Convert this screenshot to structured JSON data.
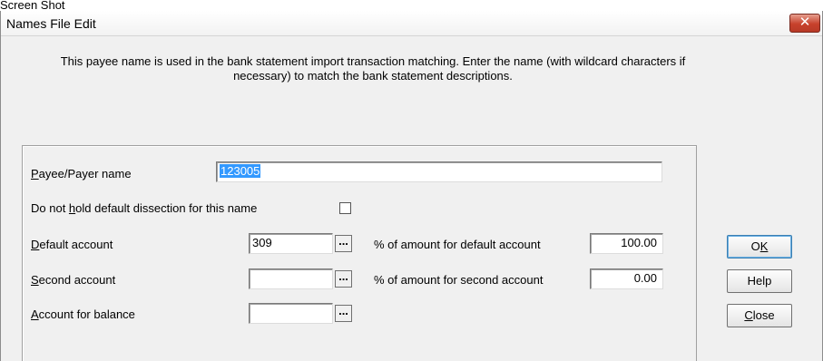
{
  "top_label": "Screen Shot",
  "window": {
    "title": "Names File Edit",
    "close_glyph": "✕",
    "description": "This payee name is used in the bank statement import transaction matching. Enter the name (with wildcard characters if necessary) to match the bank statement descriptions."
  },
  "form": {
    "payee_label_hotkey": "P",
    "payee_label_rest": "ayee/Payer name",
    "payee_value": "123005",
    "hold_label_pre": "Do not ",
    "hold_label_hotkey": "h",
    "hold_label_post": "old default dissection for this name",
    "hold_checked": false,
    "default_label_hotkey": "D",
    "default_label_rest": "efault account",
    "default_value": "309",
    "default_pct_label": "% of amount for default account",
    "default_pct_value": "100.00",
    "second_label_hotkey": "S",
    "second_label_rest": "econd account",
    "second_value": "",
    "second_pct_label": "% of amount for second account",
    "second_pct_value": "0.00",
    "balance_label_hotkey": "A",
    "balance_label_rest": "ccount for balance",
    "balance_value": "",
    "browse_glyph": "..."
  },
  "buttons": {
    "ok_pre": "O",
    "ok_hotkey": "K",
    "help": "Help",
    "close_hotkey": "C",
    "close_rest": "lose"
  }
}
